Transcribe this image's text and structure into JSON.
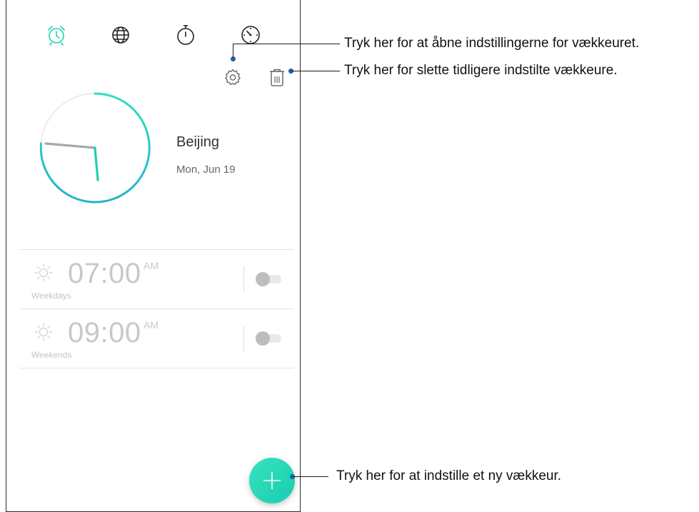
{
  "tabs": [
    {
      "name": "alarm",
      "icon": "alarm-clock-icon",
      "active": true
    },
    {
      "name": "world-clock",
      "icon": "globe-icon",
      "active": false
    },
    {
      "name": "stopwatch",
      "icon": "stopwatch-icon",
      "active": false
    },
    {
      "name": "timer",
      "icon": "timer-icon",
      "active": false
    }
  ],
  "toolbar": {
    "settings_icon": "gear-icon",
    "delete_icon": "trash-icon"
  },
  "world_clock": {
    "city": "Beijing",
    "date": "Mon, Jun 19"
  },
  "alarms": [
    {
      "time": "07:00",
      "ampm": "AM",
      "days": "Weekdays",
      "enabled": false,
      "icon": "sun-icon"
    },
    {
      "time": "09:00",
      "ampm": "AM",
      "days": "Weekends",
      "enabled": false,
      "icon": "sun-icon"
    }
  ],
  "fab": {
    "icon": "plus-icon"
  },
  "callouts": {
    "settings": "Tryk her for at åbne indstillingerne for vækkeuret.",
    "delete": "Tryk her for slette tidligere indstilte vækkeure.",
    "add": "Tryk her for at indstille et ny vækkeur."
  },
  "colors": {
    "accent": "#1fd3b4",
    "callout_dot": "#1b5fa8"
  }
}
